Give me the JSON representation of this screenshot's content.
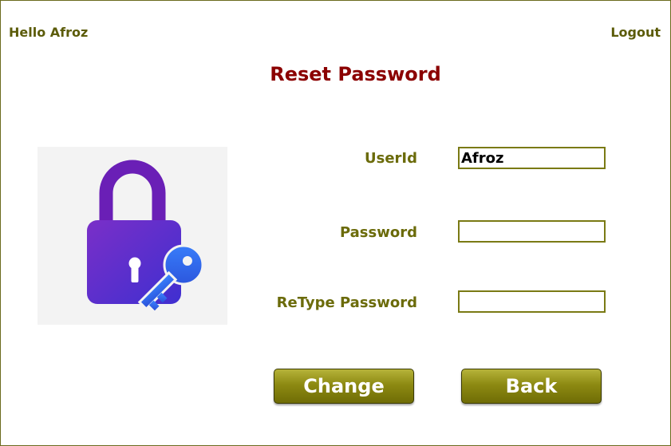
{
  "header": {
    "greeting": "Hello Afroz",
    "logout_label": "Logout"
  },
  "page": {
    "title": "Reset Password"
  },
  "form": {
    "userid_label": "UserId",
    "userid_value": "Afroz",
    "password_label": "Password",
    "password_value": "",
    "retype_label": "ReType Password",
    "retype_value": ""
  },
  "buttons": {
    "change_label": "Change",
    "back_label": "Back"
  },
  "colors": {
    "accent_olive": "#8d8a12",
    "title_red": "#8b0000",
    "lock_purple": "#6a1fb6",
    "key_blue": "#2e6bf2"
  },
  "icons": {
    "lock": "lock-icon",
    "key": "key-icon"
  }
}
